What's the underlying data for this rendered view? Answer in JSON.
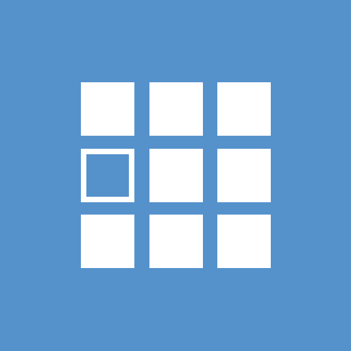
{
  "icon": {
    "name": "grid-icon",
    "background_color": "#5592cc",
    "foreground_color": "#ffffff",
    "grid": {
      "rows": 3,
      "cols": 3,
      "cells": [
        [
          "filled",
          "filled",
          "filled"
        ],
        [
          "outlined",
          "filled",
          "filled"
        ],
        [
          "filled",
          "filled",
          "filled"
        ]
      ]
    }
  }
}
